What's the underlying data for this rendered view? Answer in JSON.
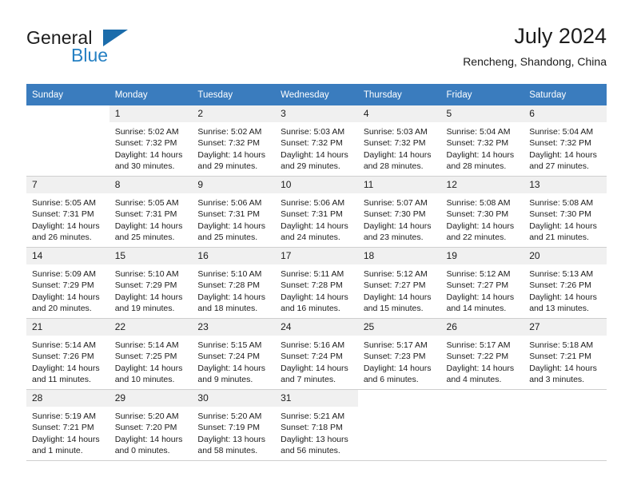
{
  "brand": {
    "name_part1": "General",
    "name_part2": "Blue",
    "triangle_color": "#1b6cab",
    "accent_color": "#2580c3"
  },
  "header": {
    "title": "July 2024",
    "subtitle": "Rencheng, Shandong, China",
    "header_bg": "#3a7cbe"
  },
  "calendar": {
    "weekday_headers": [
      "Sunday",
      "Monday",
      "Tuesday",
      "Wednesday",
      "Thursday",
      "Friday",
      "Saturday"
    ],
    "weeks": [
      [
        {
          "day": "",
          "lines": []
        },
        {
          "day": "1",
          "lines": [
            "Sunrise: 5:02 AM",
            "Sunset: 7:32 PM",
            "Daylight: 14 hours",
            "and 30 minutes."
          ]
        },
        {
          "day": "2",
          "lines": [
            "Sunrise: 5:02 AM",
            "Sunset: 7:32 PM",
            "Daylight: 14 hours",
            "and 29 minutes."
          ]
        },
        {
          "day": "3",
          "lines": [
            "Sunrise: 5:03 AM",
            "Sunset: 7:32 PM",
            "Daylight: 14 hours",
            "and 29 minutes."
          ]
        },
        {
          "day": "4",
          "lines": [
            "Sunrise: 5:03 AM",
            "Sunset: 7:32 PM",
            "Daylight: 14 hours",
            "and 28 minutes."
          ]
        },
        {
          "day": "5",
          "lines": [
            "Sunrise: 5:04 AM",
            "Sunset: 7:32 PM",
            "Daylight: 14 hours",
            "and 28 minutes."
          ]
        },
        {
          "day": "6",
          "lines": [
            "Sunrise: 5:04 AM",
            "Sunset: 7:32 PM",
            "Daylight: 14 hours",
            "and 27 minutes."
          ]
        }
      ],
      [
        {
          "day": "7",
          "lines": [
            "Sunrise: 5:05 AM",
            "Sunset: 7:31 PM",
            "Daylight: 14 hours",
            "and 26 minutes."
          ]
        },
        {
          "day": "8",
          "lines": [
            "Sunrise: 5:05 AM",
            "Sunset: 7:31 PM",
            "Daylight: 14 hours",
            "and 25 minutes."
          ]
        },
        {
          "day": "9",
          "lines": [
            "Sunrise: 5:06 AM",
            "Sunset: 7:31 PM",
            "Daylight: 14 hours",
            "and 25 minutes."
          ]
        },
        {
          "day": "10",
          "lines": [
            "Sunrise: 5:06 AM",
            "Sunset: 7:31 PM",
            "Daylight: 14 hours",
            "and 24 minutes."
          ]
        },
        {
          "day": "11",
          "lines": [
            "Sunrise: 5:07 AM",
            "Sunset: 7:30 PM",
            "Daylight: 14 hours",
            "and 23 minutes."
          ]
        },
        {
          "day": "12",
          "lines": [
            "Sunrise: 5:08 AM",
            "Sunset: 7:30 PM",
            "Daylight: 14 hours",
            "and 22 minutes."
          ]
        },
        {
          "day": "13",
          "lines": [
            "Sunrise: 5:08 AM",
            "Sunset: 7:30 PM",
            "Daylight: 14 hours",
            "and 21 minutes."
          ]
        }
      ],
      [
        {
          "day": "14",
          "lines": [
            "Sunrise: 5:09 AM",
            "Sunset: 7:29 PM",
            "Daylight: 14 hours",
            "and 20 minutes."
          ]
        },
        {
          "day": "15",
          "lines": [
            "Sunrise: 5:10 AM",
            "Sunset: 7:29 PM",
            "Daylight: 14 hours",
            "and 19 minutes."
          ]
        },
        {
          "day": "16",
          "lines": [
            "Sunrise: 5:10 AM",
            "Sunset: 7:28 PM",
            "Daylight: 14 hours",
            "and 18 minutes."
          ]
        },
        {
          "day": "17",
          "lines": [
            "Sunrise: 5:11 AM",
            "Sunset: 7:28 PM",
            "Daylight: 14 hours",
            "and 16 minutes."
          ]
        },
        {
          "day": "18",
          "lines": [
            "Sunrise: 5:12 AM",
            "Sunset: 7:27 PM",
            "Daylight: 14 hours",
            "and 15 minutes."
          ]
        },
        {
          "day": "19",
          "lines": [
            "Sunrise: 5:12 AM",
            "Sunset: 7:27 PM",
            "Daylight: 14 hours",
            "and 14 minutes."
          ]
        },
        {
          "day": "20",
          "lines": [
            "Sunrise: 5:13 AM",
            "Sunset: 7:26 PM",
            "Daylight: 14 hours",
            "and 13 minutes."
          ]
        }
      ],
      [
        {
          "day": "21",
          "lines": [
            "Sunrise: 5:14 AM",
            "Sunset: 7:26 PM",
            "Daylight: 14 hours",
            "and 11 minutes."
          ]
        },
        {
          "day": "22",
          "lines": [
            "Sunrise: 5:14 AM",
            "Sunset: 7:25 PM",
            "Daylight: 14 hours",
            "and 10 minutes."
          ]
        },
        {
          "day": "23",
          "lines": [
            "Sunrise: 5:15 AM",
            "Sunset: 7:24 PM",
            "Daylight: 14 hours",
            "and 9 minutes."
          ]
        },
        {
          "day": "24",
          "lines": [
            "Sunrise: 5:16 AM",
            "Sunset: 7:24 PM",
            "Daylight: 14 hours",
            "and 7 minutes."
          ]
        },
        {
          "day": "25",
          "lines": [
            "Sunrise: 5:17 AM",
            "Sunset: 7:23 PM",
            "Daylight: 14 hours",
            "and 6 minutes."
          ]
        },
        {
          "day": "26",
          "lines": [
            "Sunrise: 5:17 AM",
            "Sunset: 7:22 PM",
            "Daylight: 14 hours",
            "and 4 minutes."
          ]
        },
        {
          "day": "27",
          "lines": [
            "Sunrise: 5:18 AM",
            "Sunset: 7:21 PM",
            "Daylight: 14 hours",
            "and 3 minutes."
          ]
        }
      ],
      [
        {
          "day": "28",
          "lines": [
            "Sunrise: 5:19 AM",
            "Sunset: 7:21 PM",
            "Daylight: 14 hours",
            "and 1 minute."
          ]
        },
        {
          "day": "29",
          "lines": [
            "Sunrise: 5:20 AM",
            "Sunset: 7:20 PM",
            "Daylight: 14 hours",
            "and 0 minutes."
          ]
        },
        {
          "day": "30",
          "lines": [
            "Sunrise: 5:20 AM",
            "Sunset: 7:19 PM",
            "Daylight: 13 hours",
            "and 58 minutes."
          ]
        },
        {
          "day": "31",
          "lines": [
            "Sunrise: 5:21 AM",
            "Sunset: 7:18 PM",
            "Daylight: 13 hours",
            "and 56 minutes."
          ]
        },
        {
          "day": "",
          "lines": []
        },
        {
          "day": "",
          "lines": []
        },
        {
          "day": "",
          "lines": []
        }
      ]
    ]
  }
}
